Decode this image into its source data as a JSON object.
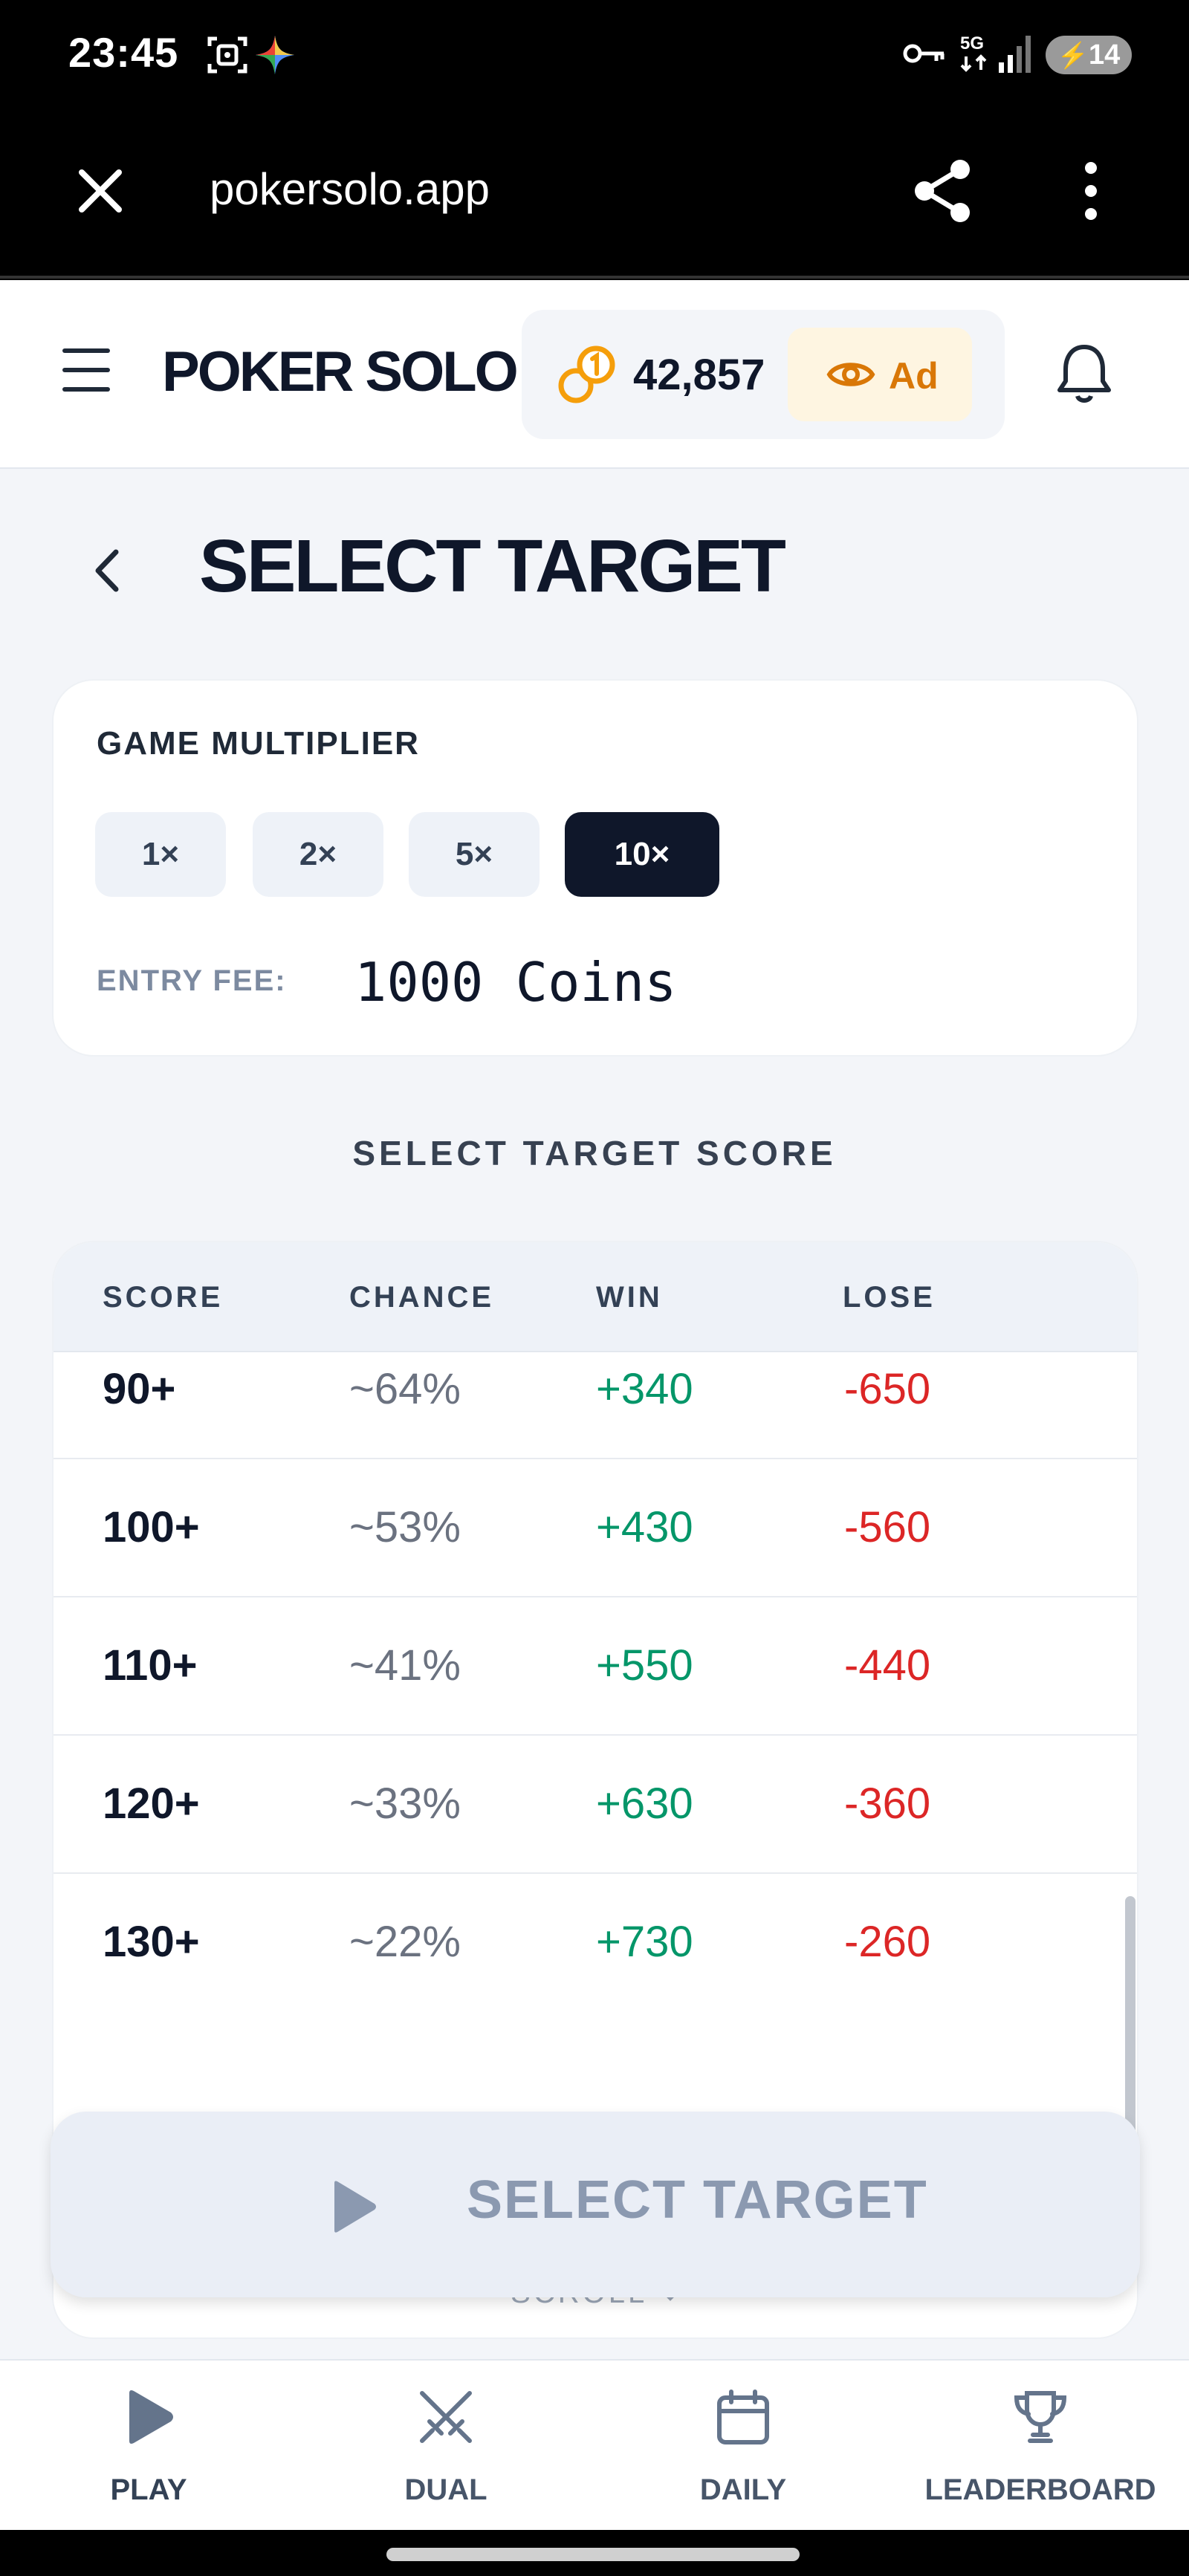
{
  "status_bar": {
    "time": "23:45",
    "battery": "14",
    "icons": [
      "screenshot-icon",
      "gemini-icon",
      "vpn-key-icon",
      "5g-icon",
      "signal-icon",
      "battery-icon"
    ]
  },
  "browser": {
    "url": "pokersolo.app",
    "icons": [
      "close-icon",
      "share-icon",
      "more-vert-icon"
    ]
  },
  "header": {
    "brand": "POKER SOLO",
    "coins": "42,857",
    "ad_label": "Ad",
    "icons": [
      "menu-icon",
      "coins-icon",
      "eye-icon",
      "bell-icon"
    ]
  },
  "page": {
    "title": "SELECT TARGET",
    "back_icon": "chevron-left-icon"
  },
  "multiplier": {
    "label": "GAME MULTIPLIER",
    "options": [
      "1×",
      "2×",
      "5×",
      "10×"
    ],
    "selected": "10×",
    "entry_fee_label": "ENTRY FEE:",
    "entry_fee_value": "1000 Coins"
  },
  "target_table": {
    "section_title": "SELECT TARGET SCORE",
    "columns": [
      "SCORE",
      "CHANCE",
      "WIN",
      "LOSE"
    ],
    "rows": [
      {
        "score": "90+",
        "chance": "~64%",
        "win": "+340",
        "lose": "-650"
      },
      {
        "score": "100+",
        "chance": "~53%",
        "win": "+430",
        "lose": "-560"
      },
      {
        "score": "110+",
        "chance": "~41%",
        "win": "+550",
        "lose": "-440"
      },
      {
        "score": "120+",
        "chance": "~33%",
        "win": "+630",
        "lose": "-360"
      },
      {
        "score": "130+",
        "chance": "~22%",
        "win": "+730",
        "lose": "-260"
      }
    ],
    "scroll_hint": "SCROLL",
    "scroll_icon": "chevron-down-icon"
  },
  "select_button": {
    "label": "SELECT TARGET",
    "icon": "play-icon"
  },
  "bottom_nav": {
    "items": [
      {
        "label": "PLAY",
        "icon": "play-icon"
      },
      {
        "label": "DUAL",
        "icon": "crossed-swords-icon"
      },
      {
        "label": "DAILY",
        "icon": "calendar-icon"
      },
      {
        "label": "LEADERBOARD",
        "icon": "trophy-icon"
      }
    ]
  },
  "colors": {
    "primary_dark": "#0f172a",
    "win_green": "#059669",
    "lose_red": "#dc2626",
    "ad_orange": "#d97706",
    "coin_orange": "#f59e0b",
    "nav_icon": "#64748b"
  }
}
